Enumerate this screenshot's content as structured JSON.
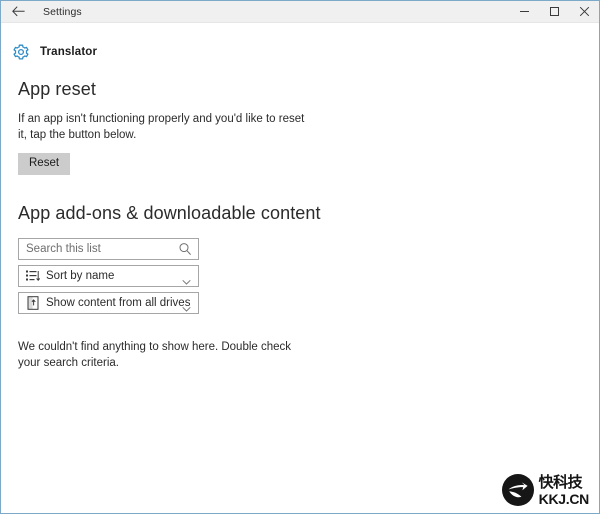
{
  "window": {
    "titlebar": {
      "back_icon": "back-arrow-icon",
      "title": "Settings",
      "minimize_label": "Minimize",
      "maximize_label": "Maximize",
      "close_label": "Close"
    },
    "border_color": "#7ca9c8",
    "titlebar_bg": "#f0f0f0"
  },
  "app_header": {
    "icon": "gear-icon",
    "icon_color": "#2e8bc8",
    "name": "Translator"
  },
  "sections": {
    "app_reset": {
      "heading": "App reset",
      "description": "If an app isn't functioning properly and you'd like to reset it, tap the button below.",
      "button_label": "Reset",
      "button_bg": "#cccccc"
    },
    "addons": {
      "heading": "App add-ons & downloadable content",
      "search": {
        "placeholder": "Search this list",
        "value": "",
        "icon": "search-icon"
      },
      "sort_dropdown": {
        "icon": "sort-list-icon",
        "value": "Sort by name",
        "chevron": "chevron-down-icon"
      },
      "drives_dropdown": {
        "icon": "drive-icon",
        "value": "Show content from all drives",
        "chevron": "chevron-down-icon"
      },
      "empty_message": "We couldn't find anything to show here. Double check your search criteria."
    }
  },
  "watermark": {
    "logo_icon": "kkj-swoosh-logo",
    "chinese_text": "快科技",
    "latin_text": "KKJ.CN",
    "color": "#161616"
  }
}
